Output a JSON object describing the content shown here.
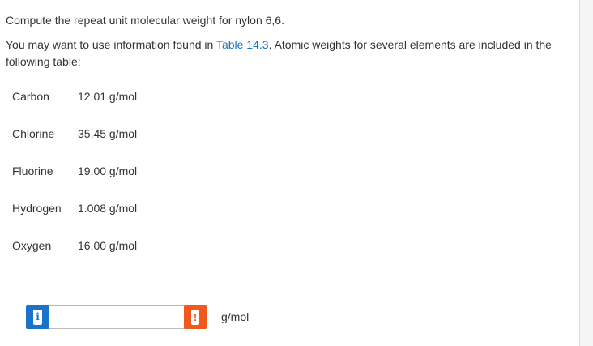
{
  "question": "Compute the repeat unit molecular weight for nylon 6,6.",
  "info": {
    "before": "You may want to use information found in ",
    "link": "Table 14.3",
    "after": ". Atomic weights for several elements are included in the following table:"
  },
  "atomic_weights": [
    {
      "element": "Carbon",
      "weight": "12.01 g/mol"
    },
    {
      "element": "Chlorine",
      "weight": "35.45 g/mol"
    },
    {
      "element": "Fluorine",
      "weight": "19.00 g/mol"
    },
    {
      "element": "Hydrogen",
      "weight": "1.008 g/mol"
    },
    {
      "element": "Oxygen",
      "weight": "16.00 g/mol"
    }
  ],
  "answer": {
    "value": "",
    "info_icon_glyph": "i",
    "warning_icon_glyph": "!",
    "unit": "g/mol",
    "info_icon": "info-icon",
    "warning_icon": "exclamation-icon"
  },
  "colors": {
    "link": "#1a73c8",
    "info_button": "#1a73c8",
    "warning_button": "#f0581e"
  }
}
